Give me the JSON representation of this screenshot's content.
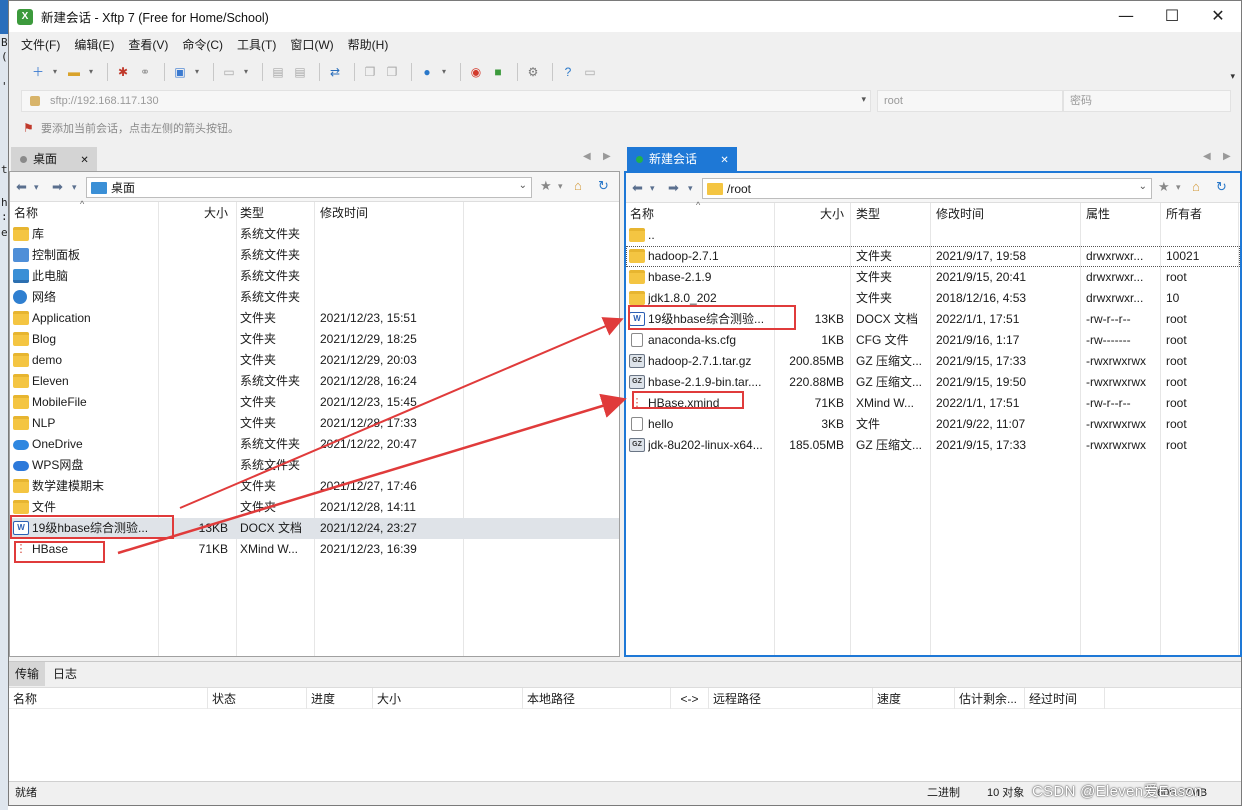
{
  "window": {
    "title": "新建会话 - Xftp 7 (Free for Home/School)",
    "controls": {
      "minimize": "—",
      "maximize": "☐",
      "close": "✕"
    }
  },
  "menu": [
    "文件(F)",
    "编辑(E)",
    "查看(V)",
    "命令(C)",
    "工具(T)",
    "窗口(W)",
    "帮助(H)"
  ],
  "address": {
    "url": "sftp://192.168.117.130",
    "user_placeholder": "root",
    "password_placeholder": "密码"
  },
  "hint": "要添加当前会话，点击左侧的箭头按钮。",
  "left": {
    "tab_label": "桌面",
    "path": "桌面",
    "columns": [
      "名称",
      "大小",
      "类型",
      "修改时间"
    ],
    "rows": [
      {
        "name": "库",
        "size": "",
        "type": "系统文件夹",
        "modified": "",
        "icon": "sysfolder"
      },
      {
        "name": "控制面板",
        "size": "",
        "type": "系统文件夹",
        "modified": "",
        "icon": "cp"
      },
      {
        "name": "此电脑",
        "size": "",
        "type": "系统文件夹",
        "modified": "",
        "icon": "pc"
      },
      {
        "name": "网络",
        "size": "",
        "type": "系统文件夹",
        "modified": "",
        "icon": "net"
      },
      {
        "name": "Application",
        "size": "",
        "type": "文件夹",
        "modified": "2021/12/23, 15:51",
        "icon": "folder"
      },
      {
        "name": "Blog",
        "size": "",
        "type": "文件夹",
        "modified": "2021/12/29, 18:25",
        "icon": "folder"
      },
      {
        "name": "demo",
        "size": "",
        "type": "文件夹",
        "modified": "2021/12/29, 20:03",
        "icon": "folder"
      },
      {
        "name": "Eleven",
        "size": "",
        "type": "系统文件夹",
        "modified": "2021/12/28, 16:24",
        "icon": "folder"
      },
      {
        "name": "MobileFile",
        "size": "",
        "type": "文件夹",
        "modified": "2021/12/23, 15:45",
        "icon": "folder"
      },
      {
        "name": "NLP",
        "size": "",
        "type": "文件夹",
        "modified": "2021/12/28, 17:33",
        "icon": "folder"
      },
      {
        "name": "OneDrive",
        "size": "",
        "type": "系统文件夹",
        "modified": "2021/12/22, 20:47",
        "icon": "cloud"
      },
      {
        "name": "WPS网盘",
        "size": "",
        "type": "系统文件夹",
        "modified": "",
        "icon": "wps"
      },
      {
        "name": "数学建模期末",
        "size": "",
        "type": "文件夹",
        "modified": "2021/12/27, 17:46",
        "icon": "folder"
      },
      {
        "name": "文件",
        "size": "",
        "type": "文件夹",
        "modified": "2021/12/28, 14:11",
        "icon": "folder"
      },
      {
        "name": "19级hbase综合测验...",
        "size": "13KB",
        "type": "DOCX 文档",
        "modified": "2021/12/24, 23:27",
        "icon": "docx"
      },
      {
        "name": "HBase",
        "size": "71KB",
        "type": "XMind W...",
        "modified": "2021/12/23, 16:39",
        "icon": "xmind"
      }
    ]
  },
  "right": {
    "tab_label": "新建会话",
    "path": "/root",
    "columns": [
      "名称",
      "大小",
      "类型",
      "修改时间",
      "属性",
      "所有者"
    ],
    "rows": [
      {
        "name": "..",
        "size": "",
        "type": "",
        "modified": "",
        "attr": "",
        "owner": "",
        "icon": "parent"
      },
      {
        "name": "hadoop-2.7.1",
        "size": "",
        "type": "文件夹",
        "modified": "2021/9/17, 19:58",
        "attr": "drwxrwxr...",
        "owner": "10021",
        "icon": "folder"
      },
      {
        "name": "hbase-2.1.9",
        "size": "",
        "type": "文件夹",
        "modified": "2021/9/15, 20:41",
        "attr": "drwxrwxr...",
        "owner": "root",
        "icon": "folder"
      },
      {
        "name": "jdk1.8.0_202",
        "size": "",
        "type": "文件夹",
        "modified": "2018/12/16, 4:53",
        "attr": "drwxrwxr...",
        "owner": "10",
        "icon": "folder"
      },
      {
        "name": "19级hbase综合测验...",
        "size": "13KB",
        "type": "DOCX 文档",
        "modified": "2022/1/1, 17:51",
        "attr": "-rw-r--r--",
        "owner": "root",
        "icon": "docx"
      },
      {
        "name": "anaconda-ks.cfg",
        "size": "1KB",
        "type": "CFG 文件",
        "modified": "2021/9/16, 1:17",
        "attr": "-rw-------",
        "owner": "root",
        "icon": "file"
      },
      {
        "name": "hadoop-2.7.1.tar.gz",
        "size": "200.85MB",
        "type": "GZ 压缩文...",
        "modified": "2021/9/15, 17:33",
        "attr": "-rwxrwxrwx",
        "owner": "root",
        "icon": "gz"
      },
      {
        "name": "hbase-2.1.9-bin.tar....",
        "size": "220.88MB",
        "type": "GZ 压缩文...",
        "modified": "2021/9/15, 19:50",
        "attr": "-rwxrwxrwx",
        "owner": "root",
        "icon": "gz"
      },
      {
        "name": "HBase.xmind",
        "size": "71KB",
        "type": "XMind W...",
        "modified": "2022/1/1, 17:51",
        "attr": "-rw-r--r--",
        "owner": "root",
        "icon": "xmind"
      },
      {
        "name": "hello",
        "size": "3KB",
        "type": "文件",
        "modified": "2021/9/22, 11:07",
        "attr": "-rwxrwxrwx",
        "owner": "root",
        "icon": "file"
      },
      {
        "name": "jdk-8u202-linux-x64...",
        "size": "185.05MB",
        "type": "GZ 压缩文...",
        "modified": "2021/9/15, 17:33",
        "attr": "-rwxrwxrwx",
        "owner": "root",
        "icon": "gz"
      }
    ]
  },
  "bottom_tabs": [
    "传输",
    "日志"
  ],
  "transfer_columns": [
    "名称",
    "状态",
    "进度",
    "大小",
    "本地路径",
    "<->",
    "远程路径",
    "速度",
    "估计剩余...",
    "经过时间"
  ],
  "status": {
    "left": "就绪",
    "mode": "二进制",
    "count": "10 对象",
    "size": "605.57MB"
  },
  "watermark": "CSDN @Eleven爱Eason",
  "edge_glyphs": [
    "B",
    "(",
    "'",
    "t",
    "h",
    ":",
    "e"
  ],
  "colors": {
    "accent": "#1e78d6",
    "annotation_red": "#e03b3b",
    "session_dot": "#22b14c"
  }
}
